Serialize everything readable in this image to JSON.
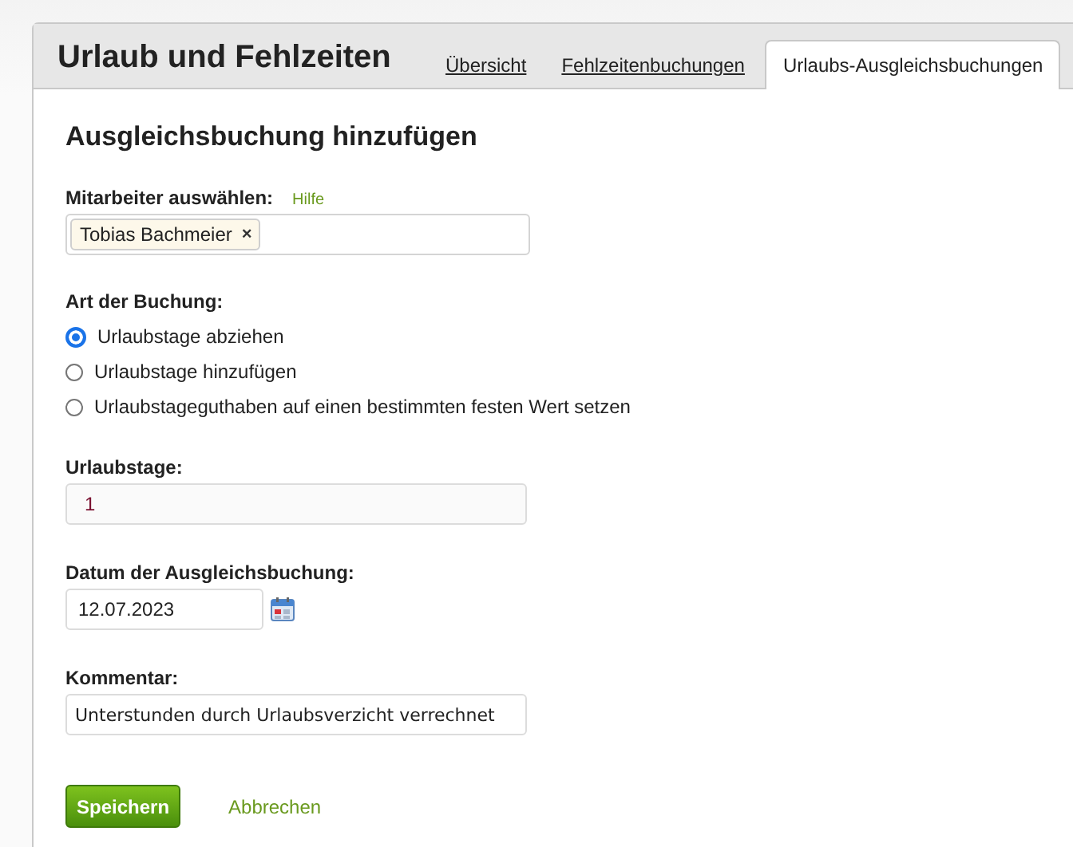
{
  "header": {
    "title": "Urlaub und Fehlzeiten"
  },
  "tabs": [
    {
      "label": "Übersicht",
      "selected": false
    },
    {
      "label": "Fehlzeitenbuchungen",
      "selected": false
    },
    {
      "label": "Urlaubs-Ausgleichsbuchungen",
      "selected": true
    }
  ],
  "form": {
    "heading": "Ausgleichsbuchung hinzufügen",
    "employee": {
      "label": "Mitarbeiter auswählen:",
      "help_link": "Hilfe",
      "tags": [
        {
          "name": "Tobias Bachmeier",
          "remove": "×"
        }
      ]
    },
    "booking_type": {
      "label": "Art der Buchung:",
      "options": [
        {
          "label": "Urlaubstage abziehen",
          "selected": true
        },
        {
          "label": "Urlaubstage hinzufügen",
          "selected": false
        },
        {
          "label": "Urlaubstageguthaben auf einen bestimmten festen Wert setzen",
          "selected": false
        }
      ]
    },
    "days": {
      "label": "Urlaubstage:",
      "value": "1"
    },
    "date": {
      "label": "Datum der Ausgleichsbuchung:",
      "value": "12.07.2023"
    },
    "comment": {
      "label": "Kommentar:",
      "value": "Unterstunden durch Urlaubsverzicht verrechnet"
    },
    "buttons": {
      "save": "Speichern",
      "cancel": "Abbrechen"
    }
  }
}
